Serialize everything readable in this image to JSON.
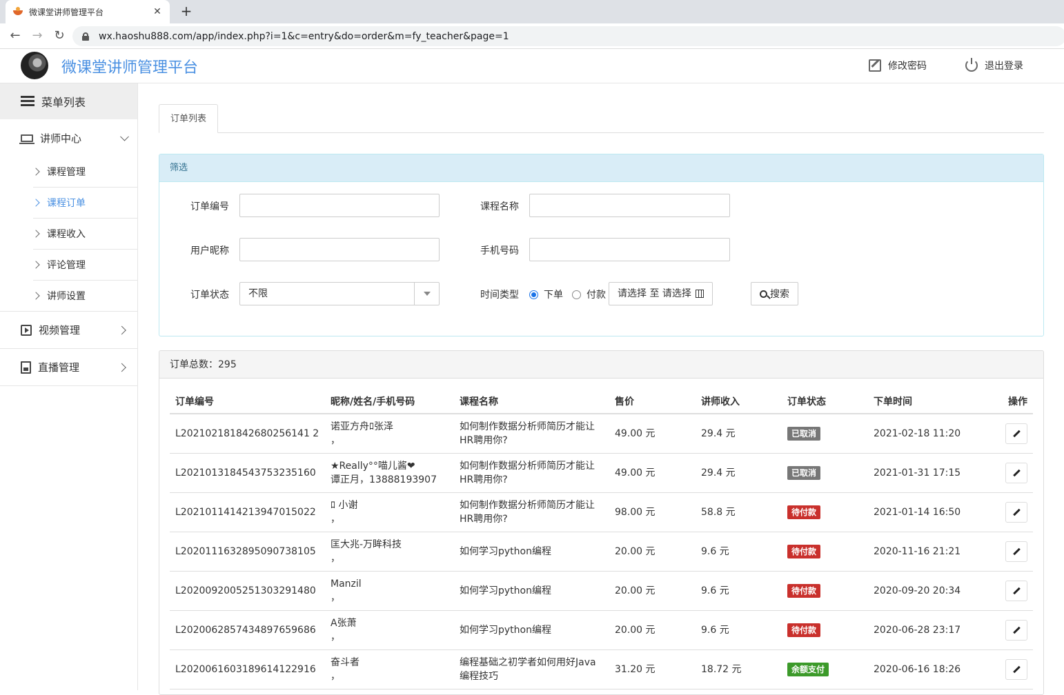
{
  "browser": {
    "tab_title": "微课堂讲师管理平台",
    "url": "wx.haoshu888.com/app/index.php?i=1&c=entry&do=order&m=fy_teacher&page=1"
  },
  "header": {
    "title": "微课堂讲师管理平台",
    "change_password": "修改密码",
    "logout": "退出登录",
    "title_color": "#4a90e2"
  },
  "sidebar": {
    "menu_title": "菜单列表",
    "groups": [
      {
        "label": "讲师中心",
        "icon": "laptop-icon",
        "expanded": true
      },
      {
        "label": "视频管理",
        "icon": "video-icon",
        "expanded": false
      },
      {
        "label": "直播管理",
        "icon": "live-icon",
        "expanded": false
      }
    ],
    "subitems": [
      {
        "label": "课程管理"
      },
      {
        "label": "课程订单",
        "active": true
      },
      {
        "label": "课程收入"
      },
      {
        "label": "评论管理"
      },
      {
        "label": "讲师设置"
      }
    ]
  },
  "main": {
    "tab": "订单列表",
    "filter": {
      "title": "筛选",
      "order_no_label": "订单编号",
      "course_name_label": "课程名称",
      "nickname_label": "用户昵称",
      "phone_label": "手机号码",
      "status_label": "订单状态",
      "status_value": "不限",
      "time_type_label": "时间类型",
      "radio_order": "下单",
      "radio_pay": "付款",
      "date_range": "请选择 至 请选择",
      "search": "搜索"
    },
    "orders": {
      "total_label": "订单总数：295",
      "columns": [
        "订单编号",
        "昵称/姓名/手机号码",
        "课程名称",
        "售价",
        "讲师收入",
        "订单状态",
        "下单时间",
        "操作"
      ],
      "rows": [
        {
          "id": "L202102181842680256141 2",
          "user1": "诺亚方舟ﾛ张泽",
          "user2": "，",
          "course": "如何制作数据分析师简历才能让HR聘用你?",
          "price": "49.00 元",
          "income": "29.4 元",
          "status": "已取消",
          "status_color": "#777777",
          "time": "2021-02-18 11:20"
        },
        {
          "id": "L20210131845437532351 60",
          "user1": "★Really°°喵儿酱❤",
          "user2": "谭正月，13888193907",
          "course": "如何制作数据分析师简历才能让HR聘用你?",
          "price": "49.00 元",
          "income": "29.4 元",
          "status": "已取消",
          "status_color": "#777777",
          "time": "2021-01-31 17:15"
        },
        {
          "id": "L20210114142139470150 22",
          "user1": "ﾛ 小谢",
          "user2": "，",
          "course": "如何制作数据分析师简历才能让HR聘用你?",
          "price": "98.00 元",
          "income": "58.8 元",
          "status": "待付款",
          "status_color": "#c9302c",
          "time": "2021-01-14 16:50"
        },
        {
          "id": "L20201116328950907381 05",
          "user1": "匡大兆-万眸科技",
          "user2": "，",
          "course": "如何学习python编程",
          "price": "20.00 元",
          "income": "9.6 元",
          "status": "待付款",
          "status_color": "#c9302c",
          "time": "2020-11-16 21:21"
        },
        {
          "id": "L20200920052513032914 80",
          "user1": "Manzil",
          "user2": "，",
          "course": "如何学习python编程",
          "price": "20.00 元",
          "income": "9.6 元",
          "status": "待付款",
          "status_color": "#c9302c",
          "time": "2020-09-20 20:34"
        },
        {
          "id": "L20200628574348976596 86",
          "user1": "A张萧",
          "user2": "，",
          "course": "如何学习python编程",
          "price": "20.00 元",
          "income": "9.6 元",
          "status": "待付款",
          "status_color": "#c9302c",
          "time": "2020-06-28 23:17"
        },
        {
          "id": "L20200616031896141229 16",
          "user1": "奋斗者",
          "user2": "，",
          "course": "编程基础之初学者如何用好Java编程技巧",
          "price": "31.20 元",
          "income": "18.72 元",
          "status": "余额支付",
          "status_color": "#3c9a2a",
          "time": "2020-06-16 18:26"
        }
      ]
    }
  }
}
